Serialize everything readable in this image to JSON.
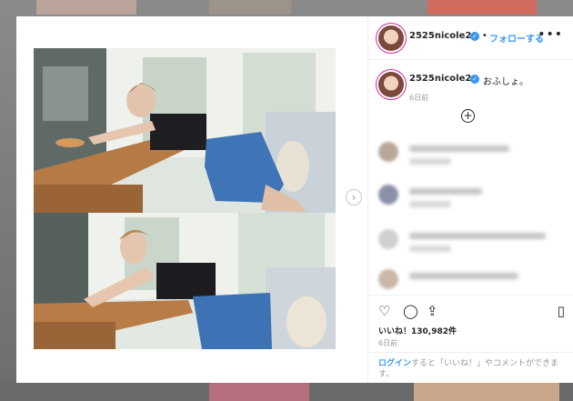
{
  "post": {
    "username": "2525nicole2",
    "follow_label": "フォローする",
    "separator": "•",
    "caption": "おふしょ。",
    "caption_time": "6日前",
    "likes_label": "いいね！",
    "likes_count": "130,982件",
    "date": "6日前",
    "login_link": "ログイン",
    "login_rest": "すると「いいね！」やコメントができます。"
  },
  "comments": [
    {
      "avatar_color": "#b8a89a"
    },
    {
      "avatar_color": "#8a90a8"
    },
    {
      "avatar_color": "#d0d0d0"
    },
    {
      "avatar_color": "#c9b7a8"
    }
  ],
  "icons": {
    "verified": "✓",
    "more": "•••",
    "plus": "+",
    "heart": "♡",
    "comment": "◯",
    "share": "⇪",
    "bookmark": "▯",
    "next": "›"
  }
}
